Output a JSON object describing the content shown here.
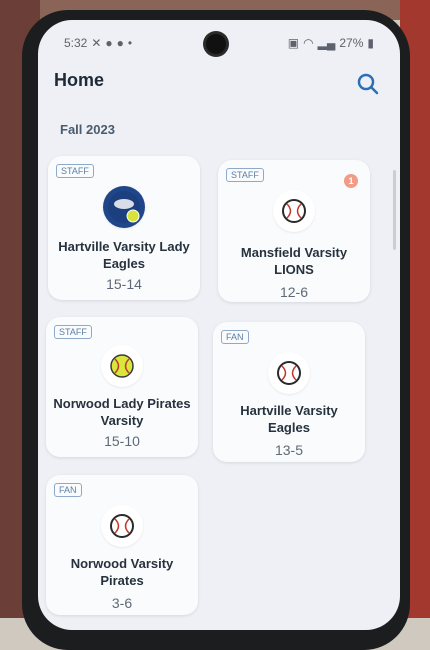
{
  "status": {
    "time": "5:32",
    "icons": [
      "x-icon",
      "notification-icon",
      "notification-icon",
      "dot-icon"
    ],
    "battery": "27%"
  },
  "header": {
    "title": "Home"
  },
  "season": "Fall 2023",
  "teams": [
    {
      "role": "STAFF",
      "name": "Hartville Varsity Lady Eagles",
      "record": "15-14",
      "logo": "eagles-logo",
      "badge": ""
    },
    {
      "role": "STAFF",
      "name": "Mansfield Varsity LIONS",
      "record": "12-6",
      "logo": "baseball-icon",
      "badge": "1"
    },
    {
      "role": "STAFF",
      "name": "Norwood Lady Pirates Varsity",
      "record": "15-10",
      "logo": "softball-icon",
      "badge": ""
    },
    {
      "role": "FAN",
      "name": "Hartville Varsity Eagles",
      "record": "13-5",
      "logo": "baseball-icon",
      "badge": ""
    },
    {
      "role": "FAN",
      "name": "Norwood Varsity Pirates",
      "record": "3-6",
      "logo": "baseball-icon",
      "badge": ""
    }
  ],
  "colors": {
    "accent": "#2d6fb6",
    "background": "#eef0f5",
    "card": "#fafbfc"
  }
}
